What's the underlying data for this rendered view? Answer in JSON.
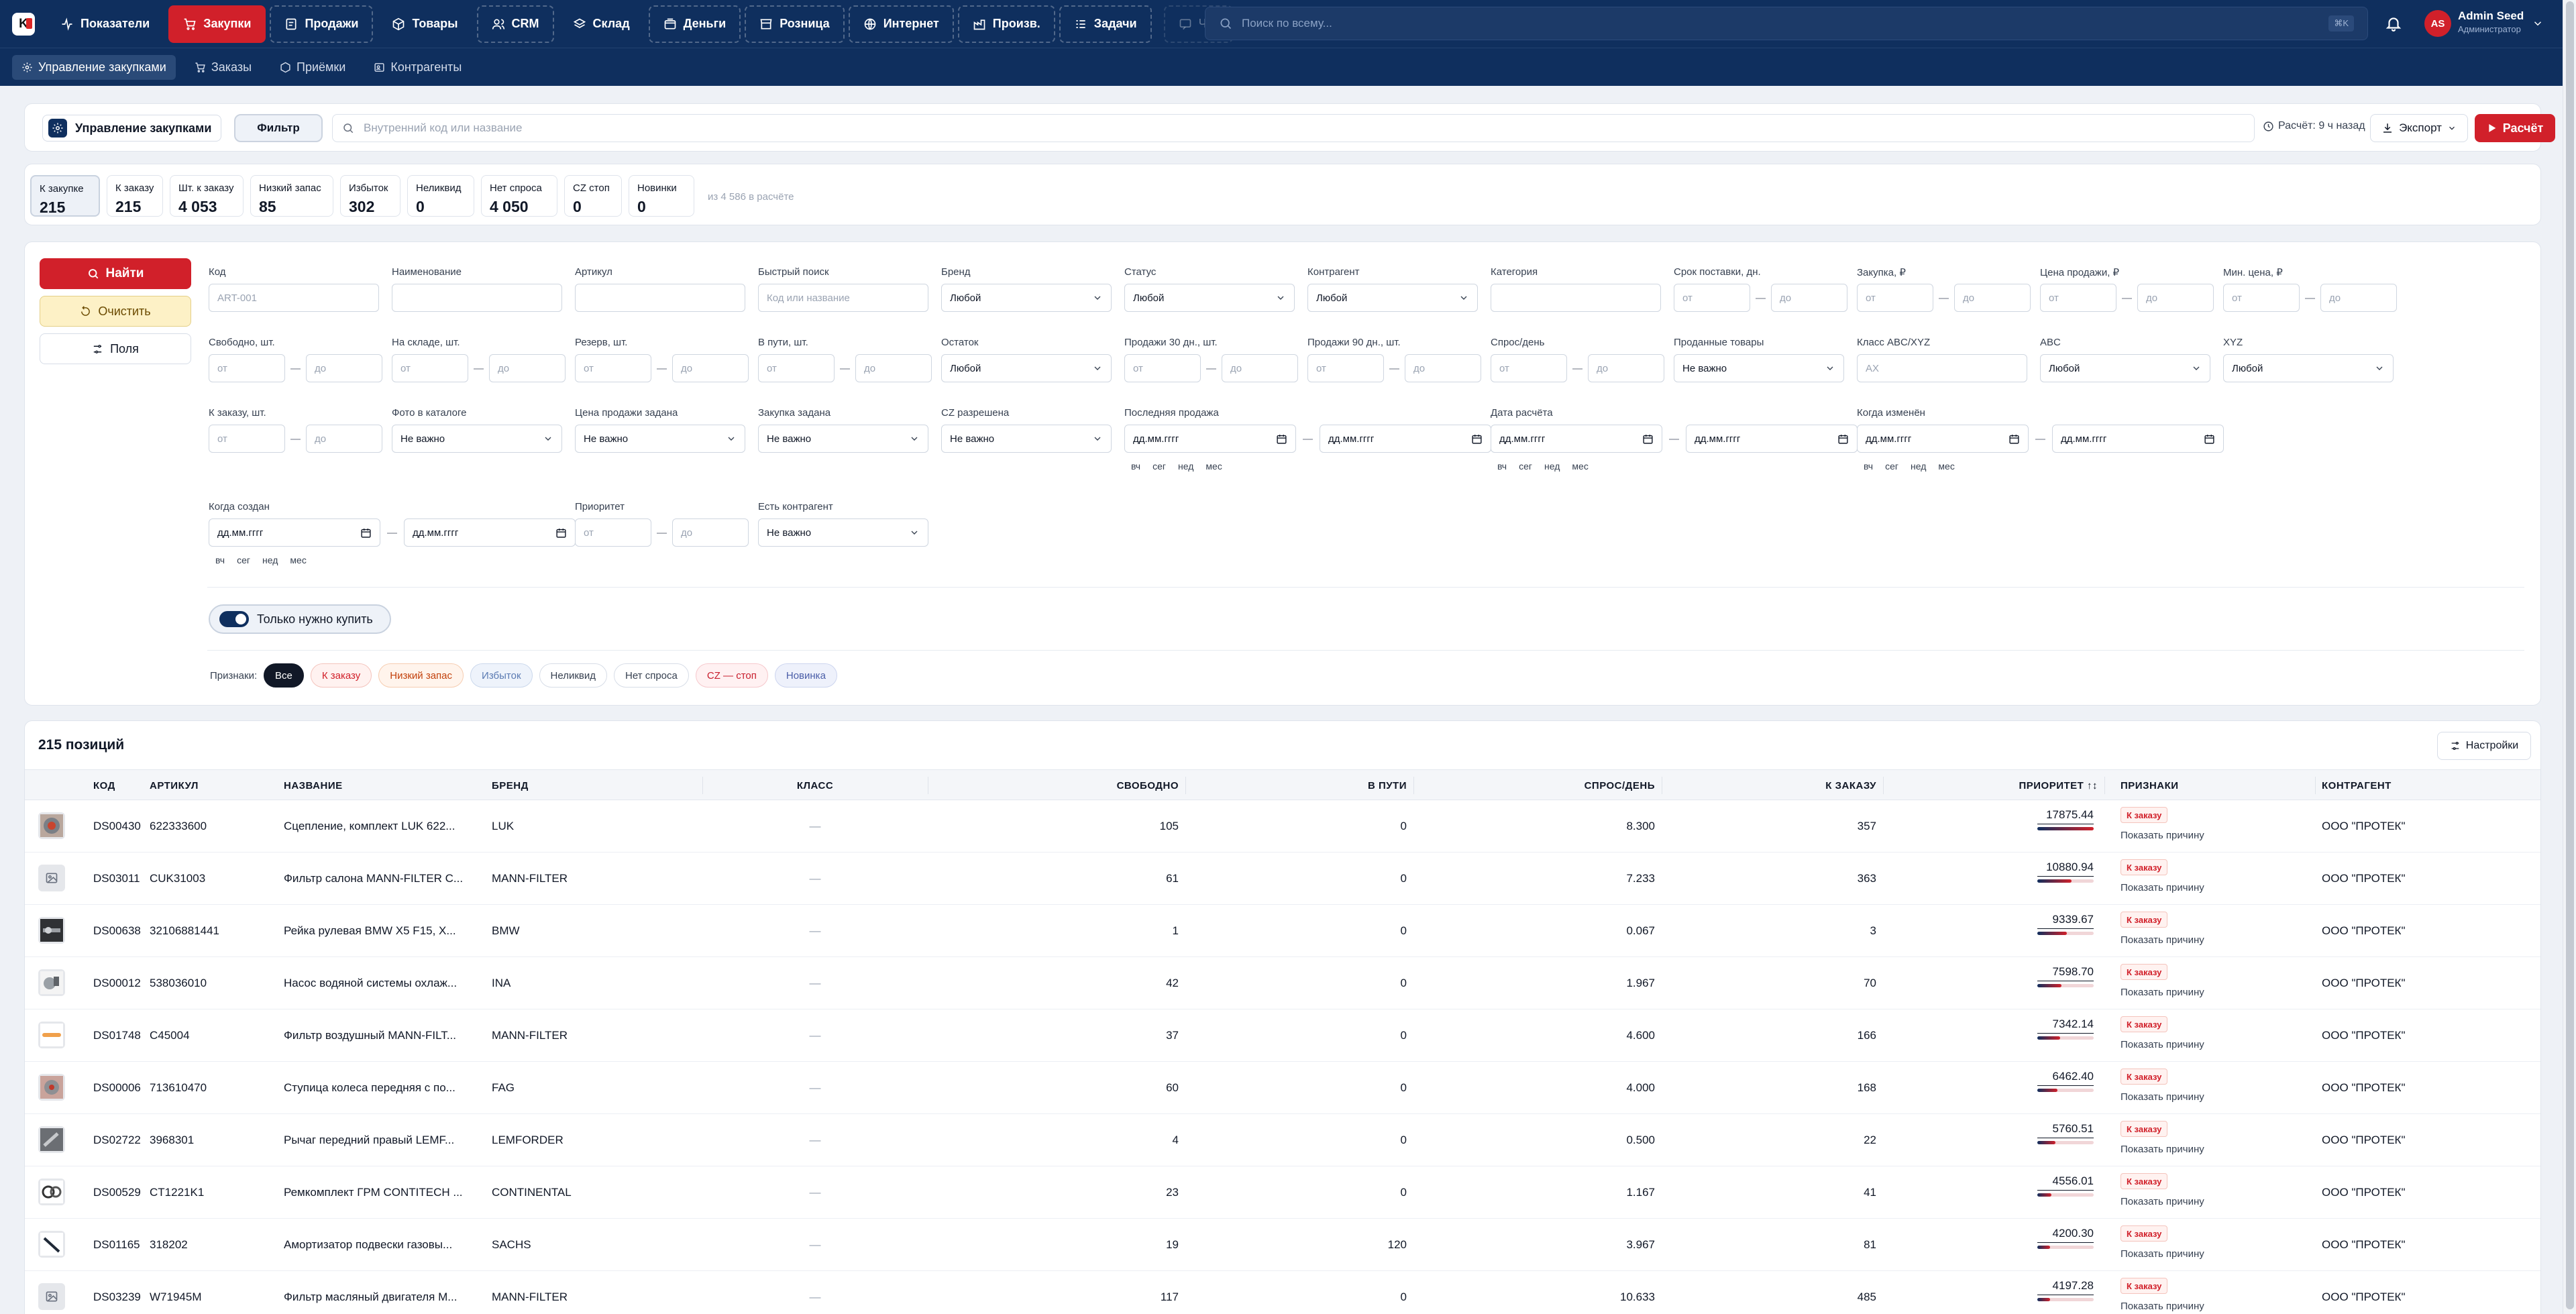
{
  "app": {
    "logo": "K"
  },
  "nav": [
    {
      "label": "Показатели",
      "icon": "activity-icon"
    },
    {
      "label": "Закупки",
      "icon": "cart-icon",
      "active": true
    },
    {
      "label": "Продажи",
      "icon": "receipt-icon"
    },
    {
      "label": "Товары",
      "icon": "box-icon"
    },
    {
      "label": "CRM",
      "icon": "users-icon"
    },
    {
      "label": "Склад",
      "icon": "layers-icon"
    },
    {
      "label": "Деньги",
      "icon": "wallet-icon"
    },
    {
      "label": "Розница",
      "icon": "store-icon"
    },
    {
      "label": "Интернет",
      "icon": "globe-icon"
    },
    {
      "label": "Произв.",
      "icon": "factory-icon"
    },
    {
      "label": "Задачи",
      "icon": "tasks-icon"
    },
    {
      "label": "Чат",
      "icon": "chat-icon",
      "disabled": true
    }
  ],
  "search": {
    "placeholder": "Поиск по всему...",
    "shortcut": "⌘K"
  },
  "user": {
    "initials": "AS",
    "name": "Admin Seed",
    "role": "Администратор"
  },
  "subnav": [
    {
      "label": "Управление закупками",
      "active": true
    },
    {
      "label": "Заказы"
    },
    {
      "label": "Приёмки"
    },
    {
      "label": "Контрагенты"
    }
  ],
  "toolbar": {
    "title": "Управление закупками",
    "filter": "Фильтр",
    "search_placeholder": "Внутренний код или название",
    "calc_info": "Расчёт: 9 ч назад",
    "export": "Экспорт",
    "run": "Расчёт"
  },
  "stats": [
    {
      "label": "К закупке",
      "value": "215",
      "active": true
    },
    {
      "label": "К заказу",
      "value": "215"
    },
    {
      "label": "Шт. к заказу",
      "value": "4 053"
    },
    {
      "label": "Низкий запас",
      "value": "85"
    },
    {
      "label": "Избыток",
      "value": "302"
    },
    {
      "label": "Неликвид",
      "value": "0"
    },
    {
      "label": "Нет спроса",
      "value": "4 050"
    },
    {
      "label": "CZ стоп",
      "value": "0"
    },
    {
      "label": "Новинки",
      "value": "0"
    }
  ],
  "stats_note": "из 4 586 в расчёте",
  "filters": {
    "find": "Найти",
    "clear": "Очистить",
    "fields": "Поля",
    "range_from": "от",
    "range_to": "до",
    "date_placeholder": "дд.мм.гггг",
    "quick": [
      "вч",
      "сег",
      "нед",
      "мес"
    ],
    "code": {
      "label": "Код",
      "placeholder": "ART-001"
    },
    "name": {
      "label": "Наименование"
    },
    "article": {
      "label": "Артикул"
    },
    "quick_search": {
      "label": "Быстрый поиск",
      "placeholder": "Код или название"
    },
    "brand": {
      "label": "Бренд",
      "value": "Любой"
    },
    "status": {
      "label": "Статус",
      "value": "Любой"
    },
    "contractor": {
      "label": "Контрагент",
      "value": "Любой"
    },
    "category": {
      "label": "Категория"
    },
    "lead_time": {
      "label": "Срок поставки, дн."
    },
    "purchase": {
      "label": "Закупка, ₽"
    },
    "sale_price": {
      "label": "Цена продажи, ₽"
    },
    "min_price": {
      "label": "Мин. цена, ₽"
    },
    "free": {
      "label": "Свободно, шт."
    },
    "in_stock": {
      "label": "На складе, шт."
    },
    "reserve": {
      "label": "Резерв, шт."
    },
    "in_transit": {
      "label": "В пути, шт."
    },
    "remainder": {
      "label": "Остаток",
      "value": "Любой"
    },
    "sales30": {
      "label": "Продажи 30 дн., шт."
    },
    "sales90": {
      "label": "Продажи 90 дн., шт."
    },
    "demand": {
      "label": "Спрос/день"
    },
    "sold": {
      "label": "Проданные товары",
      "value": "Не важно"
    },
    "abcxyz": {
      "label": "Класс ABC/XYZ",
      "placeholder": "AX"
    },
    "abc": {
      "label": "ABC",
      "value": "Любой"
    },
    "xyz": {
      "label": "XYZ",
      "value": "Любой"
    },
    "to_order": {
      "label": "К заказу, шт."
    },
    "photo": {
      "label": "Фото в каталоге",
      "value": "Не важно"
    },
    "price_set": {
      "label": "Цена продажи задана",
      "value": "Не важно"
    },
    "purchase_set": {
      "label": "Закупка задана",
      "value": "Не важно"
    },
    "cz": {
      "label": "CZ разрешена",
      "value": "Не важно"
    },
    "last_sale": {
      "label": "Последняя продажа"
    },
    "calc_date": {
      "label": "Дата расчёта"
    },
    "changed": {
      "label": "Когда изменён"
    },
    "created": {
      "label": "Когда создан"
    },
    "priority": {
      "label": "Приоритет"
    },
    "has_contractor": {
      "label": "Есть контрагент",
      "value": "Не важно"
    },
    "only_buy": "Только нужно купить",
    "signs_label": "Признаки:",
    "chips": [
      {
        "label": "Все",
        "style": "on"
      },
      {
        "label": "К заказу",
        "style": "red"
      },
      {
        "label": "Низкий запас",
        "style": "orange"
      },
      {
        "label": "Избыток",
        "style": "blue"
      },
      {
        "label": "Неликвид",
        "style": "plain"
      },
      {
        "label": "Нет спроса",
        "style": "plain"
      },
      {
        "label": "CZ — стоп",
        "style": "rose"
      },
      {
        "label": "Новинка",
        "style": "indigo"
      }
    ]
  },
  "table": {
    "title": "215 позиций",
    "settings": "Настройки",
    "columns": [
      "КОД",
      "АРТИКУЛ",
      "НАЗВАНИЕ",
      "БРЕНД",
      "КЛАСС",
      "СВОБОДНО",
      "В ПУТИ",
      "СПРОС/ДЕНЬ",
      "К ЗАКАЗУ",
      "ПРИОРИТЕТ ↑↕",
      "ПРИЗНАКИ",
      "КОНТРАГЕНТ"
    ],
    "tag": "К заказу",
    "why": "Показать причину",
    "rows": [
      {
        "code": "DS00430",
        "article": "622333600",
        "name": "Сцепление, комплект LUK 622...",
        "brand": "LUK",
        "cls": "—",
        "free": "105",
        "transit": "0",
        "demand": "8.300",
        "order": "357",
        "priority": "17875.44",
        "bar": 1.0,
        "contractor": "ООО \"ПРОТЕК\"",
        "thumb": "clutch"
      },
      {
        "code": "DS03011",
        "article": "CUK31003",
        "name": "Фильтр салона MANN-FILTER C...",
        "brand": "MANN-FILTER",
        "cls": "—",
        "free": "61",
        "transit": "0",
        "demand": "7.233",
        "order": "363",
        "priority": "10880.94",
        "bar": 0.61,
        "contractor": "ООО \"ПРОТЕК\"",
        "thumb": "placeholder"
      },
      {
        "code": "DS00638",
        "article": "32106881441",
        "name": "Рейка рулевая BMW X5 F15, X...",
        "brand": "BMW",
        "cls": "—",
        "free": "1",
        "transit": "0",
        "demand": "0.067",
        "order": "3",
        "priority": "9339.67",
        "bar": 0.52,
        "contractor": "ООО \"ПРОТЕК\"",
        "thumb": "rack"
      },
      {
        "code": "DS00012",
        "article": "538036010",
        "name": "Насос водяной системы охлаж...",
        "brand": "INA",
        "cls": "—",
        "free": "42",
        "transit": "0",
        "demand": "1.967",
        "order": "70",
        "priority": "7598.70",
        "bar": 0.43,
        "contractor": "ООО \"ПРОТЕК\"",
        "thumb": "pump"
      },
      {
        "code": "DS01748",
        "article": "C45004",
        "name": "Фильтр воздушный MANN-FILT...",
        "brand": "MANN-FILTER",
        "cls": "—",
        "free": "37",
        "transit": "0",
        "demand": "4.600",
        "order": "166",
        "priority": "7342.14",
        "bar": 0.41,
        "contractor": "ООО \"ПРОТЕК\"",
        "thumb": "airfilter"
      },
      {
        "code": "DS00006",
        "article": "713610470",
        "name": "Ступица колеса передняя с по...",
        "brand": "FAG",
        "cls": "—",
        "free": "60",
        "transit": "0",
        "demand": "4.000",
        "order": "168",
        "priority": "6462.40",
        "bar": 0.36,
        "contractor": "ООО \"ПРОТЕК\"",
        "thumb": "hub"
      },
      {
        "code": "DS02722",
        "article": "3968301",
        "name": "Рычаг передний правый LEMF...",
        "brand": "LEMFORDER",
        "cls": "—",
        "free": "4",
        "transit": "0",
        "demand": "0.500",
        "order": "22",
        "priority": "5760.51",
        "bar": 0.32,
        "contractor": "ООО \"ПРОТЕК\"",
        "thumb": "arm"
      },
      {
        "code": "DS00529",
        "article": "CT1221K1",
        "name": "Ремкомплект ГРМ CONTITECH ...",
        "brand": "CONTINENTAL",
        "cls": "—",
        "free": "23",
        "transit": "0",
        "demand": "1.167",
        "order": "41",
        "priority": "4556.01",
        "bar": 0.25,
        "contractor": "ООО \"ПРОТЕК\"",
        "thumb": "belt"
      },
      {
        "code": "DS01165",
        "article": "318202",
        "name": "Амортизатор подвески газовы...",
        "brand": "SACHS",
        "cls": "—",
        "free": "19",
        "transit": "120",
        "demand": "3.967",
        "order": "81",
        "priority": "4200.30",
        "bar": 0.23,
        "contractor": "ООО \"ПРОТЕК\"",
        "thumb": "shock"
      },
      {
        "code": "DS03239",
        "article": "W71945M",
        "name": "Фильтр масляный двигателя M...",
        "brand": "MANN-FILTER",
        "cls": "—",
        "free": "117",
        "transit": "0",
        "demand": "10.633",
        "order": "485",
        "priority": "4197.28",
        "bar": 0.23,
        "contractor": "ООО \"ПРОТЕК\"",
        "thumb": "placeholder"
      }
    ]
  },
  "colors": {
    "brand_navy": "#0f2f5e",
    "accent_red": "#d1202a"
  }
}
